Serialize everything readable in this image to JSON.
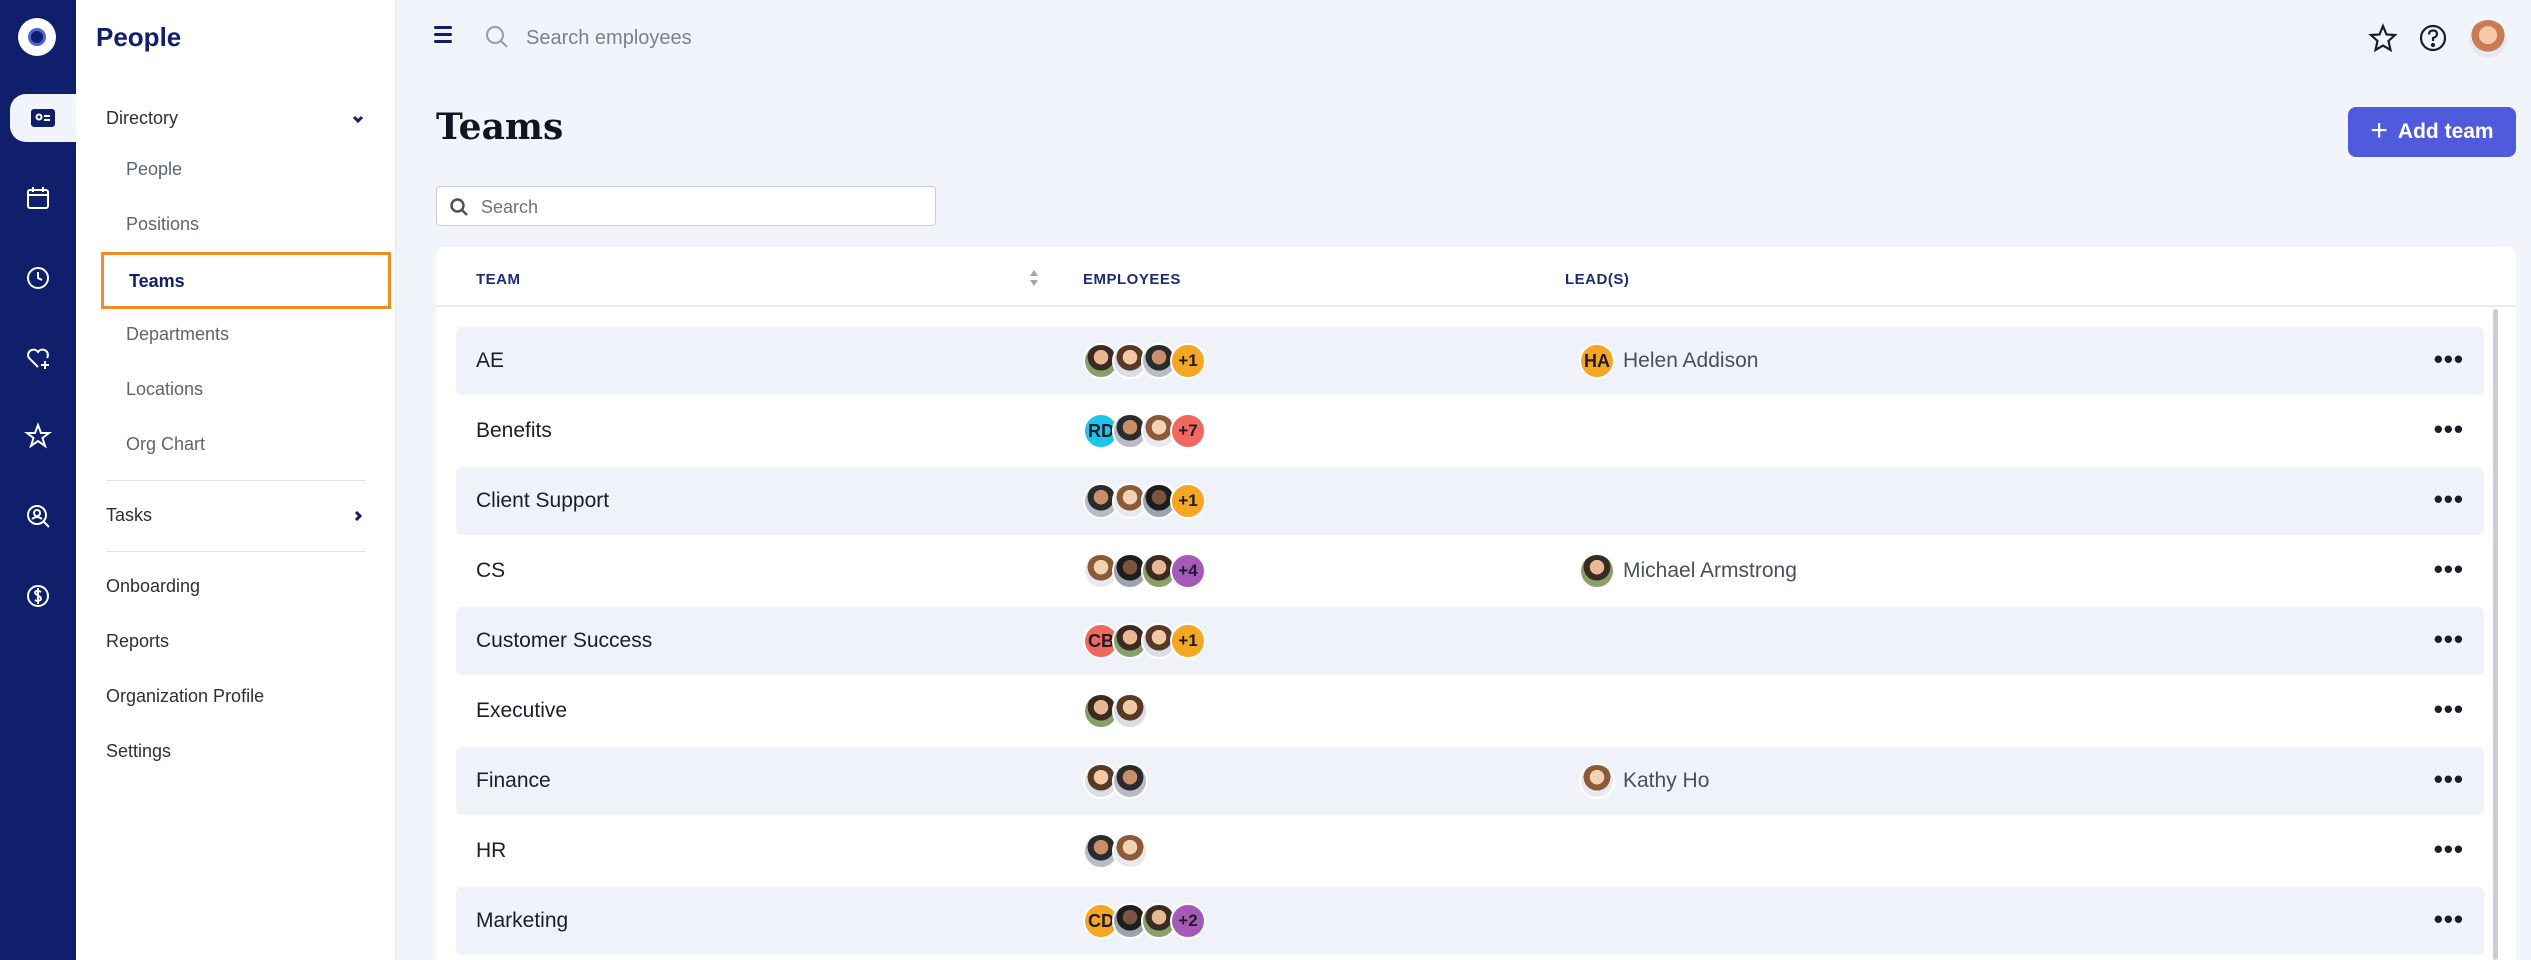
{
  "app": {
    "section_title": "People",
    "page_title": "Teams",
    "add_button_label": "Add team",
    "accent_color": "#4f5bdc",
    "nav_color": "#0f1f6b",
    "highlight_color": "#f28b22"
  },
  "rail": {
    "icons": [
      "logo-icon",
      "id-card-icon",
      "calendar-icon",
      "clock-icon",
      "heart-plus-icon",
      "star-icon",
      "search-person-icon",
      "dollar-icon"
    ]
  },
  "topbar": {
    "search_placeholder": "Search employees",
    "icons": [
      "menu-icon",
      "search-icon",
      "star-icon",
      "help-icon",
      "user-avatar"
    ]
  },
  "sidebar": {
    "directory_label": "Directory",
    "directory_items": [
      "People",
      "Positions",
      "Teams",
      "Departments",
      "Locations",
      "Org Chart"
    ],
    "active_item": "Teams",
    "tasks_label": "Tasks",
    "other_items": [
      "Onboarding",
      "Reports",
      "Organization Profile",
      "Settings"
    ]
  },
  "table": {
    "search_placeholder": "Search",
    "headers": {
      "team": "TEAM",
      "employees": "EMPLOYEES",
      "leads": "LEAD(S)"
    },
    "rows": [
      {
        "team": "AE",
        "employees": [
          {
            "type": "photo"
          },
          {
            "type": "photo"
          },
          {
            "type": "photo"
          },
          {
            "type": "more",
            "text": "+1",
            "color": "#f5a623"
          }
        ],
        "lead": {
          "name": "Helen Addison",
          "initials": "HA",
          "color": "#f5a623"
        }
      },
      {
        "team": "Benefits",
        "employees": [
          {
            "type": "initials",
            "text": "RD",
            "color": "#1cc6e8"
          },
          {
            "type": "photo"
          },
          {
            "type": "photo"
          },
          {
            "type": "more",
            "text": "+7",
            "color": "#f2685e"
          }
        ],
        "lead": null
      },
      {
        "team": "Client Support",
        "employees": [
          {
            "type": "photo"
          },
          {
            "type": "photo"
          },
          {
            "type": "photo"
          },
          {
            "type": "more",
            "text": "+1",
            "color": "#f5a623"
          }
        ],
        "lead": null
      },
      {
        "team": "CS",
        "employees": [
          {
            "type": "photo"
          },
          {
            "type": "photo"
          },
          {
            "type": "photo"
          },
          {
            "type": "more",
            "text": "+4",
            "color": "#a65ab8"
          }
        ],
        "lead": {
          "name": "Michael Armstrong",
          "initials": "",
          "color": ""
        }
      },
      {
        "team": "Customer Success",
        "employees": [
          {
            "type": "initials",
            "text": "CB",
            "color": "#f2685e"
          },
          {
            "type": "photo"
          },
          {
            "type": "photo"
          },
          {
            "type": "more",
            "text": "+1",
            "color": "#f5a623"
          }
        ],
        "lead": null
      },
      {
        "team": "Executive",
        "employees": [
          {
            "type": "photo"
          },
          {
            "type": "photo"
          }
        ],
        "lead": null
      },
      {
        "team": "Finance",
        "employees": [
          {
            "type": "photo"
          },
          {
            "type": "photo"
          }
        ],
        "lead": {
          "name": "Kathy Ho",
          "initials": "",
          "color": ""
        }
      },
      {
        "team": "HR",
        "employees": [
          {
            "type": "photo"
          },
          {
            "type": "photo"
          }
        ],
        "lead": null
      },
      {
        "team": "Marketing",
        "employees": [
          {
            "type": "initials",
            "text": "CD",
            "color": "#f5a623"
          },
          {
            "type": "photo"
          },
          {
            "type": "photo"
          },
          {
            "type": "more",
            "text": "+2",
            "color": "#a65ab8"
          }
        ],
        "lead": null
      }
    ]
  }
}
